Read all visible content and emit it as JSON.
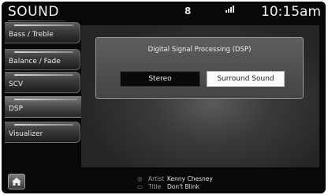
{
  "header": {
    "title": "SOUND",
    "mid_indicator": "8",
    "signal_indicator": "signal-icon",
    "time": "10:15am"
  },
  "sidebar": {
    "items": [
      {
        "label": "Bass / Treble"
      },
      {
        "label": "Balance / Fade"
      },
      {
        "label": "SCV"
      },
      {
        "label": "DSP"
      },
      {
        "label": "Visualizer"
      }
    ]
  },
  "dsp_panel": {
    "title": "Digital Signal Processing (DSP)",
    "options": [
      "Stereo",
      "Surround Sound"
    ],
    "selected": "Surround Sound"
  },
  "footer": {
    "home_icon": "home-icon",
    "artist_label": "Artist",
    "artist_value": "Kenny Chesney",
    "title_label": "Title",
    "title_value": "Don't Blink"
  }
}
